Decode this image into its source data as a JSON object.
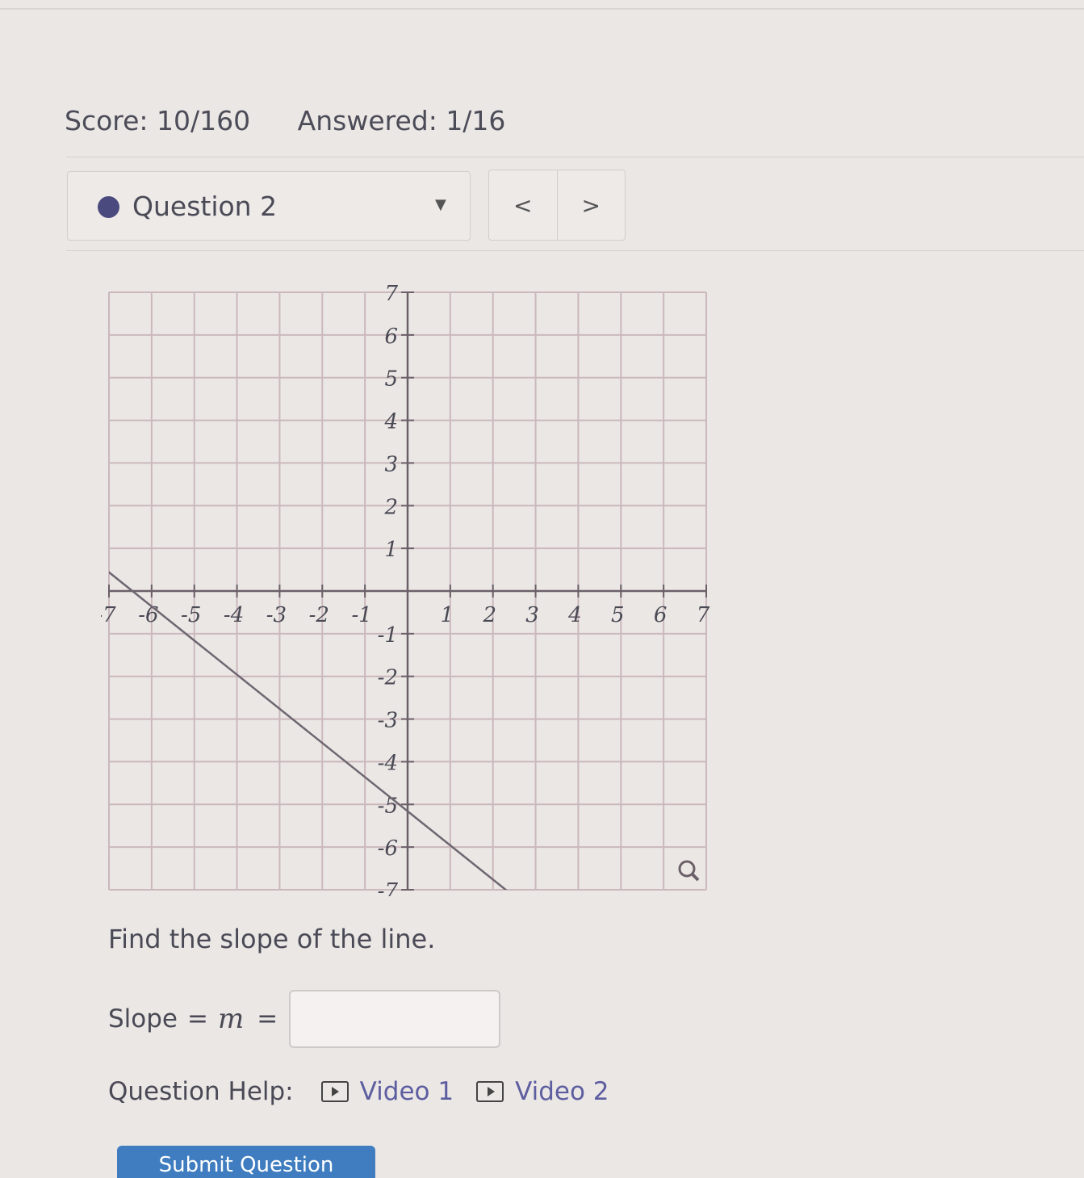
{
  "header": {
    "score": "Score: 10/160",
    "answered": "Answered: 1/16"
  },
  "question_selector": {
    "label": "Question 2",
    "status_color": "#4b4a7e"
  },
  "nav": {
    "prev_label": "<",
    "next_label": ">"
  },
  "chart_data": {
    "type": "line",
    "xlim": [
      -7,
      7
    ],
    "ylim": [
      -7,
      7
    ],
    "grid": true,
    "x_ticks": [
      "-7",
      "-6",
      "-5",
      "-4",
      "-3",
      "-2",
      "-1",
      "1",
      "2",
      "3",
      "4",
      "5",
      "6",
      "7"
    ],
    "y_ticks": [
      "7",
      "6",
      "5",
      "4",
      "3",
      "2",
      "1",
      "-1",
      "-2",
      "-3",
      "-4",
      "-5",
      "-6",
      "-7"
    ],
    "series": [
      {
        "x": [
          -7.2,
          2.8
        ],
        "y": [
          0.6,
          -7.4
        ]
      }
    ],
    "line_color": "#6e6670",
    "grid_color": "#cbb8bc",
    "axis_color": "#6b6068"
  },
  "prompt": "Find the slope of the line.",
  "slope": {
    "label": "Slope",
    "equals_sign": "=",
    "variable": "m",
    "equals_sign_2": "=",
    "value": ""
  },
  "help": {
    "label": "Question Help:",
    "video1": "Video 1",
    "video2": "Video 2",
    "icon": "play-video-icon"
  },
  "submit": {
    "label": "Submit Question",
    "color": "#3f7dc0"
  }
}
